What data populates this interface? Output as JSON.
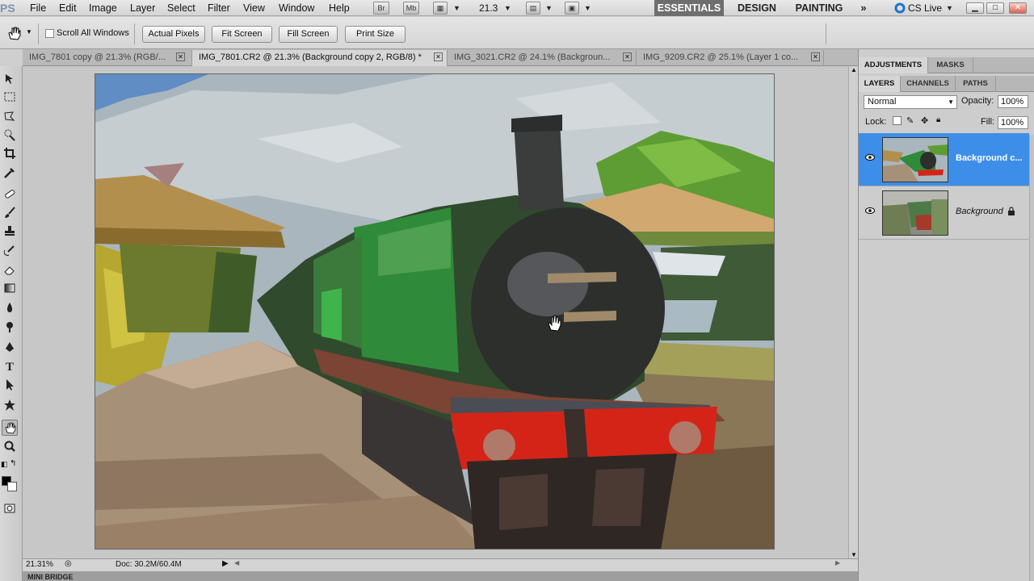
{
  "app": {
    "logo": "PS",
    "menus": [
      "File",
      "Edit",
      "Image",
      "Layer",
      "Select",
      "Filter",
      "View",
      "Window",
      "Help"
    ],
    "bridge_button": "Br",
    "minibridge_button": "Mb",
    "zoom_level": "21.3",
    "workspaces": [
      "ESSENTIALS",
      "DESIGN",
      "PAINTING"
    ],
    "more_workspaces": "»",
    "cs_live": "CS Live"
  },
  "options": {
    "scroll_all_windows": "Scroll All Windows",
    "buttons": [
      "Actual Pixels",
      "Fit Screen",
      "Fill Screen",
      "Print Size"
    ]
  },
  "tabs": [
    {
      "label": "IMG_7801 copy @ 21.3% (RGB/..."
    },
    {
      "label": "IMG_7801.CR2 @ 21.3% (Background copy 2, RGB/8) *"
    },
    {
      "label": "IMG_3021.CR2 @ 24.1% (Backgroun..."
    },
    {
      "label": "IMG_9209.CR2 @ 25.1% (Layer 1 co..."
    }
  ],
  "status": {
    "zoom": "21.31%",
    "doc": "Doc: 30.2M/60.4M",
    "mini_bridge": "MINI BRIDGE"
  },
  "panels": {
    "top_tabs": [
      "ADJUSTMENTS",
      "MASKS"
    ],
    "layer_tabs": [
      "LAYERS",
      "CHANNELS",
      "PATHS"
    ],
    "blend_mode": "Normal",
    "opacity_label": "Opacity:",
    "opacity_value": "100%",
    "lock_label": "Lock:",
    "fill_label": "Fill:",
    "fill_value": "100%",
    "layers": [
      {
        "name": "Background c...",
        "selected": true
      },
      {
        "name": "Background",
        "selected": false,
        "locked": true
      }
    ]
  },
  "colors": {
    "selection": "#3d8ee8",
    "loco_red": "#d42418",
    "loco_green": "#2f8a3a"
  }
}
